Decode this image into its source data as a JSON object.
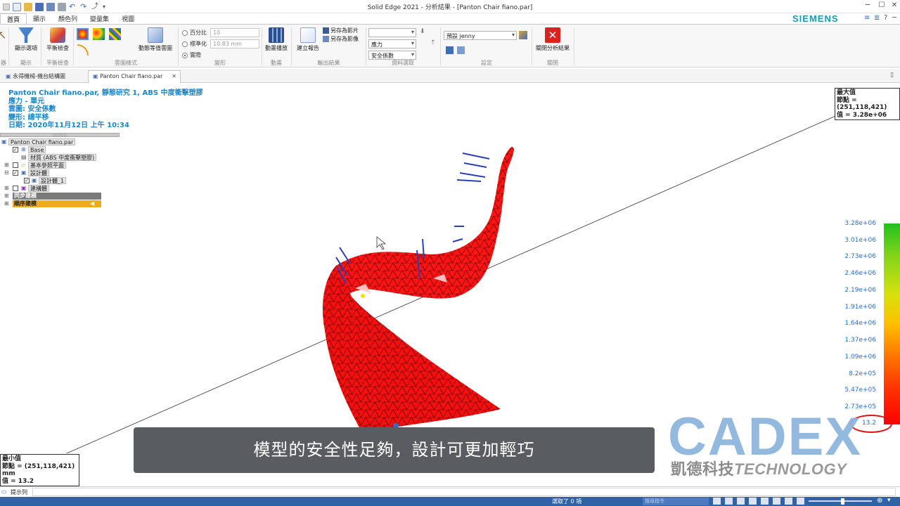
{
  "window": {
    "title": "Solid Edge 2021 - 分析結果 - [Panton Chair fiano.par]",
    "brand": "SIEMENS"
  },
  "ribbon_tabs": [
    "首頁",
    "顯示",
    "顏色列",
    "變量集",
    "視圖"
  ],
  "ribbon": {
    "show_options": "顯示選項",
    "balance_check": "平衡檢查",
    "animate_contour": "動態等值雲圖",
    "percent": "百分比",
    "percent_value": "10",
    "normalize": "標準化",
    "normalize_value": "10.83 mm",
    "actual": "實際",
    "animate_play": "動畫播放",
    "create_report": "建立報告",
    "save_as_video": "另存為影片",
    "save_as_image": "另存為影像",
    "data_dropdown_1": "",
    "data_dropdown_2": "應力",
    "data_dropdown_3": "安全係數",
    "preset": "預設 jenny",
    "close_analysis": "關閉分析結果",
    "groups": {
      "display": "顯示",
      "balance": "平衡檢查",
      "contour_style": "雲圖樣式",
      "deform": "變形",
      "animation": "動畫",
      "output": "輸出結果",
      "data_select": "資料選取",
      "settings": "設定",
      "close": "關閉",
      "left_edge": "器"
    }
  },
  "doc_tabs": [
    "永得機械-機台結構圖",
    "Panton Chair fiano.par"
  ],
  "info": {
    "line1": "Panton Chair fiano.par, 靜態研究 1, ABS 中度衝擊塑膠",
    "line2": "應力 - 單元",
    "line3": "雲圖: 安全係數",
    "line4": "變形: 總平移",
    "line5": "日期: 2020年11月12日  上午 10:34"
  },
  "tree": {
    "root": "Panton Chair fiano.par",
    "base": "Base",
    "material": "材質 (ABS 中度衝擊塑膠)",
    "ref_planes": "基本參照平面",
    "design_body": "設計體",
    "design_body_1": "設計體_1",
    "constructions": "建構體",
    "sync_model": "同步建模",
    "ordered_model": "順序建模"
  },
  "max_box": {
    "title": "最大值",
    "node": "節點 = (251,118,421)",
    "value": "值 = 3.28e+06"
  },
  "min_box": {
    "title": "最小值",
    "node": "節點 = (251,118,421) mm",
    "value": "值 = 13.2"
  },
  "legend": {
    "values": [
      "3.28e+06",
      "3.01e+06",
      "2.73e+06",
      "2.46e+06",
      "2.19e+06",
      "1.91e+06",
      "1.64e+06",
      "1.37e+06",
      "1.09e+06",
      "8.2e+05",
      "5.47e+05",
      "2.73e+05",
      "13.2"
    ],
    "gradient_top": "#22c020",
    "gradient_bottom": "#ff0000"
  },
  "subtitle": "模型的安全性足夠，設計可更加輕巧",
  "watermark": {
    "logo": "CADEX",
    "company": "凱德科技",
    "tech": "TECHNOLOGY"
  },
  "prompt_label": "提示列",
  "status": {
    "selected": "選取了 0 項",
    "search_placeholder": "搜尋指令"
  },
  "colors": {
    "accent": "#1a9bb5",
    "mesh": "#ff1a1a",
    "statusbar": "#2f63a8",
    "info_text": "#1c86c8"
  }
}
